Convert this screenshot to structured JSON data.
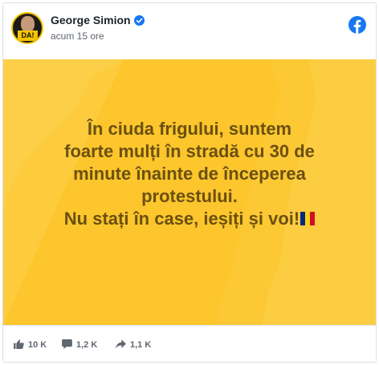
{
  "post": {
    "author": "George Simion",
    "time": "acum 15 ore",
    "avatar_badge": "DA!",
    "lines": [
      "În ciuda frigului, suntem",
      "foarte mulți în stradă cu 30 de",
      "minute înainte de începerea",
      "protestului.",
      "Nu stați în case, ieșiți și voi!"
    ],
    "flag_emoji": "romanian-flag"
  },
  "stats": {
    "likes": "10 K",
    "comments": "1,2 K",
    "shares": "1,1 K"
  },
  "colors": {
    "image_bg": "#fcc62c",
    "text": "#6b5010",
    "facebook_blue": "#1877f2"
  },
  "icons": [
    "verified-badge-icon",
    "facebook-logo-icon",
    "like-icon",
    "comment-icon",
    "share-icon"
  ]
}
